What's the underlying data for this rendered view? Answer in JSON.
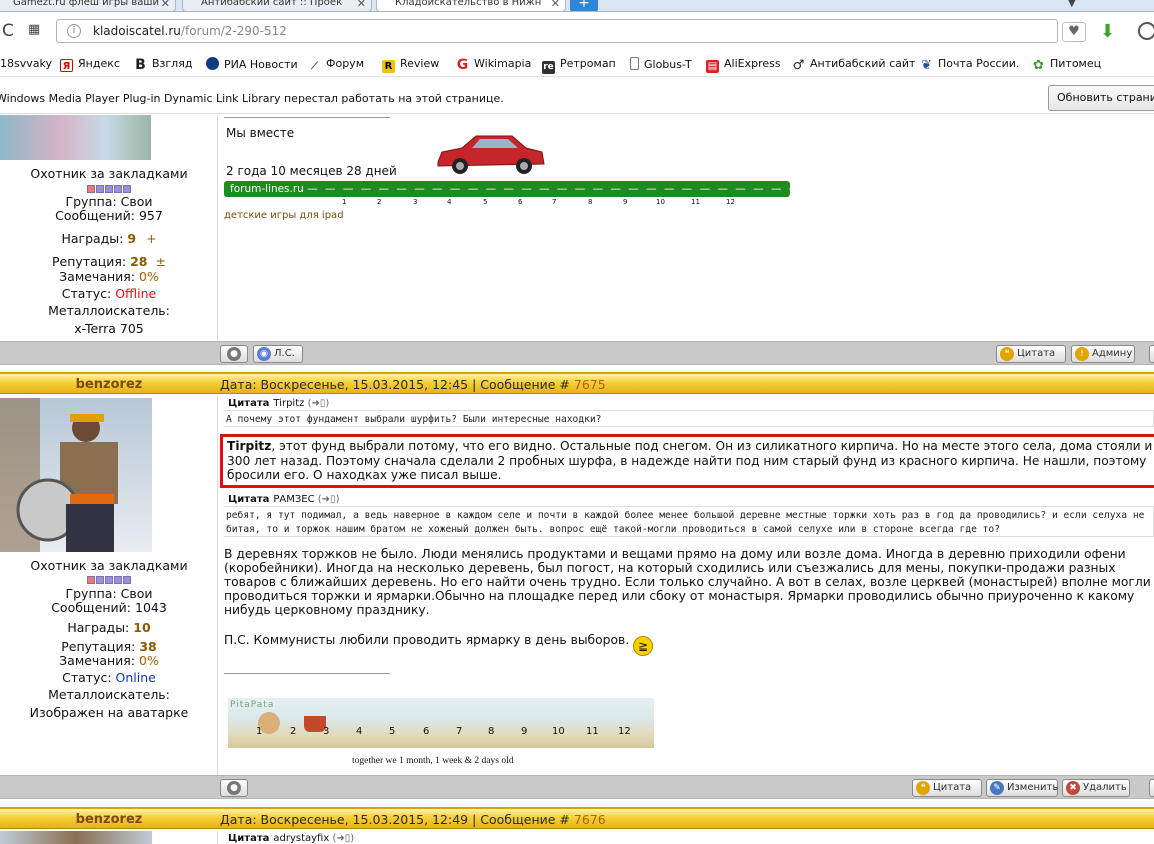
{
  "browser": {
    "tabs": [
      {
        "label": "Gamezt.ru флеш игры ваши"
      },
      {
        "label": "Антибабский сайт :: Проек"
      },
      {
        "label": "Кладоискательство в Нижн"
      }
    ],
    "url_domain": "kladoiscatel.ru",
    "url_path": "/forum/2-290-512",
    "bookmarks": [
      "18svvaky",
      "Яндекс",
      "Взгляд",
      "РИА Новости",
      "Форум",
      "Review",
      "Wikimapia",
      "Ретромап",
      "Globus-T",
      "AliExpress",
      "Антибабский сайт",
      "Почта России.",
      "Питомец"
    ],
    "plugin_message": "Windows Media Player Plug-in Dynamic Link Library перестал работать на этой странице.",
    "reload_label": "Обновить страницу"
  },
  "post_top": {
    "rank": "Охотник за закладками",
    "group_label": "Группа:",
    "group": "Свои",
    "messages_label": "Сообщений:",
    "messages": "957",
    "awards_label": "Награды:",
    "awards": "9",
    "awards_plus": "+",
    "rep_label": "Репутация:",
    "rep": "28",
    "rep_pm": "±",
    "warn_label": "Замечания:",
    "warn": "0%",
    "status_label": "Статус:",
    "status": "Offline",
    "detector_label": "Металлоискатель:",
    "detector": "x-Terra 705",
    "sig_title": "Мы вместе",
    "sig_duration": "2 года 10 месяцев 28 дней",
    "sig_site": "forum-lines.ru",
    "sig_scale": [
      "1",
      "2",
      "3",
      "4",
      "5",
      "6",
      "7",
      "8",
      "9",
      "10",
      "11",
      "12"
    ],
    "sig_link": "детские игры для ipad",
    "btn_pm": "Л.С.",
    "btn_quote": "Цитата",
    "btn_admin": "Админу"
  },
  "post_7675": {
    "author": "benzorez",
    "date_label": "Дата: Воскресенье, 15.03.2015, 12:45 | Сообщение #",
    "number": "7675",
    "quote1_label": "Цитата",
    "quote1_author": "Tirpitz",
    "quote1_text": "А почему этот фундамент выбрали шурфить? Были интересные находки?",
    "reply_bold": "Tirpitz",
    "reply_text": ", этот фунд выбрали потому, что его видно. Остальные под снегом. Он из силикатного кирпича. Но на месте этого села, дома стояли и 300 лет назад. Поэтому сначала сделали 2 пробных шурфа, в надежде найти под ним старый фунд из красного кирпича. Не нашли, поэтому бросили его. О находках уже писал выше.",
    "quote2_label": "Цитата",
    "quote2_author": "РАМЗЕС",
    "quote2_text": "ребят, я тут подимал, а ведь наверное в каждом селе и почти в каждой более менее большой деревне местные торжки хоть раз в год да проводились? и если селуха не битая, то и торжок нашим братом не хоженый должен быть. вопрос ещё такой-могли проводиться в самой селухе или в стороне всегда где то?",
    "body": "В деревнях торжков не было. Люди менялись продуктами и вещами прямо на дому или возле дома. Иногда в деревню приходили офени (коробейники). Иногда на несколько деревень, был погост, на который сходились или съезжались для мены, покупки-продажи разных товаров с ближайших деревень. Но его найти очень трудно. Если только случайно. А вот в селах, возле церквей (монастырей) вполне могли проводиться торжки и ярмарки.Обычно на площадке перед или сбоку от монастыря. Ярмарки проводились обычно приуроченно к какому нибудь церковному празднику.",
    "ps": "П.С. Коммунисты любили проводить ярмарку в день выборов.",
    "ticker_brand": "PitaPata",
    "ticker_scale": [
      "1",
      "2",
      "3",
      "4",
      "5",
      "6",
      "7",
      "8",
      "9",
      "10",
      "11",
      "12"
    ],
    "ticker_caption": "together we 1 month, 1 week & 2 days old",
    "rank": "Охотник за закладками",
    "group_label": "Группа:",
    "group": "Свои",
    "messages_label": "Сообщений:",
    "messages": "1043",
    "awards_label": "Награды:",
    "awards": "10",
    "rep_label": "Репутация:",
    "rep": "38",
    "warn_label": "Замечания:",
    "warn": "0%",
    "status_label": "Статус:",
    "status": "Online",
    "detector_label": "Металлоискатель:",
    "detector": "Изображен на аватарке",
    "btn_quote": "Цитата",
    "btn_edit": "Изменить",
    "btn_delete": "Удалить"
  },
  "post_7676": {
    "author": "benzorez",
    "date_label": "Дата: Воскресенье, 15.03.2015, 12:49 | Сообщение #",
    "number": "7676",
    "quote_label": "Цитата",
    "quote_author": "adrystayfix"
  }
}
